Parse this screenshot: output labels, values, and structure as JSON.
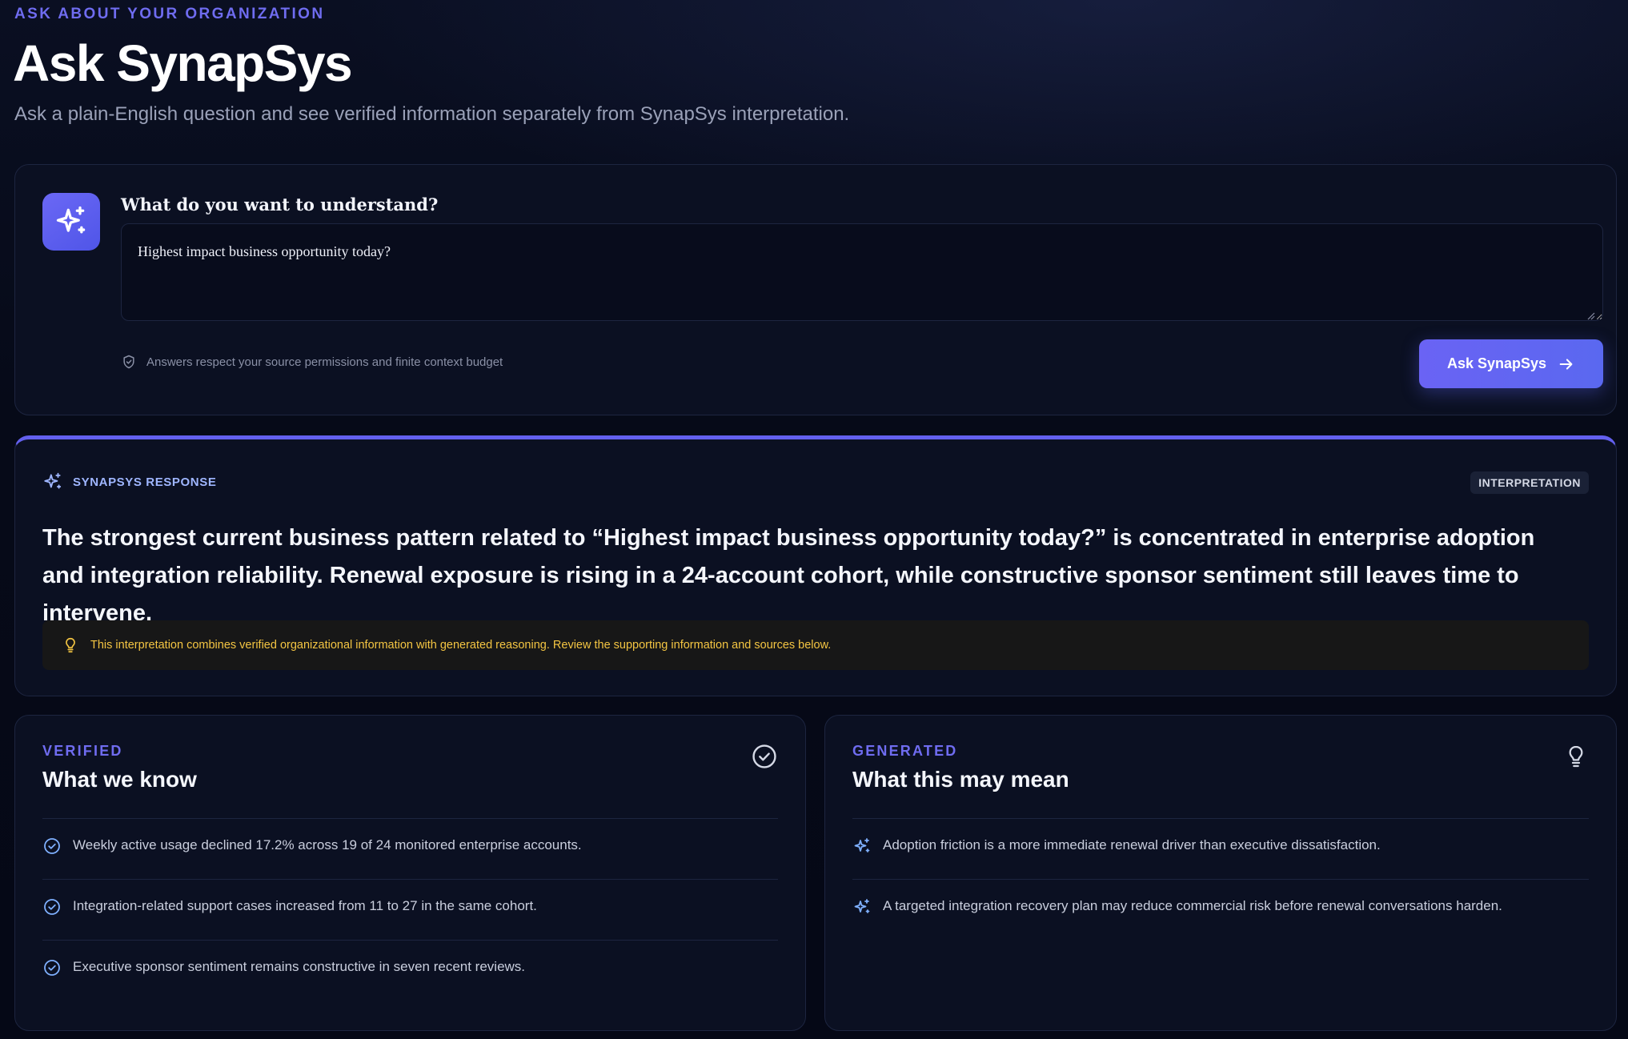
{
  "header": {
    "eyebrow": "ASK ABOUT YOUR ORGANIZATION",
    "title": "Ask SynapSys",
    "subtitle": "Ask a plain-English question and see verified information separately from SynapSys interpretation."
  },
  "ask": {
    "icon": "sparkles-icon",
    "label": "What do you want to understand?",
    "question_value": "Highest impact business opportunity today?",
    "permission_note": "Answers respect your source permissions and finite context budget",
    "button_label": "Ask SynapSys",
    "accent_color": "#6360ee"
  },
  "response": {
    "label": "SYNAPSYS RESPONSE",
    "badge": "INTERPRETATION",
    "text": "The strongest current business pattern related to “Highest impact business opportunity today?” is concentrated in enterprise adoption and integration reliability. Renewal exposure is rising in a 24-account cohort, while constructive sponsor sentiment still leaves time to intervene.",
    "caution": "This interpretation combines verified organizational information with generated reasoning. Review the supporting information and sources below.",
    "caution_color": "#f4c542"
  },
  "verified": {
    "eyebrow": "VERIFIED",
    "title": "What we know",
    "icon": "check-circle-icon",
    "items": [
      "Weekly active usage declined 17.2% across 19 of 24 monitored enterprise accounts.",
      "Integration-related support cases increased from 11 to 27 in the same cohort.",
      "Executive sponsor sentiment remains constructive in seven recent reviews."
    ]
  },
  "generated": {
    "eyebrow": "GENERATED",
    "title": "What this may mean",
    "icon": "lightbulb-icon",
    "items": [
      "Adoption friction is a more immediate renewal driver than executive dissatisfaction.",
      "A targeted integration recovery plan may reduce commercial risk before renewal conversations harden."
    ]
  }
}
